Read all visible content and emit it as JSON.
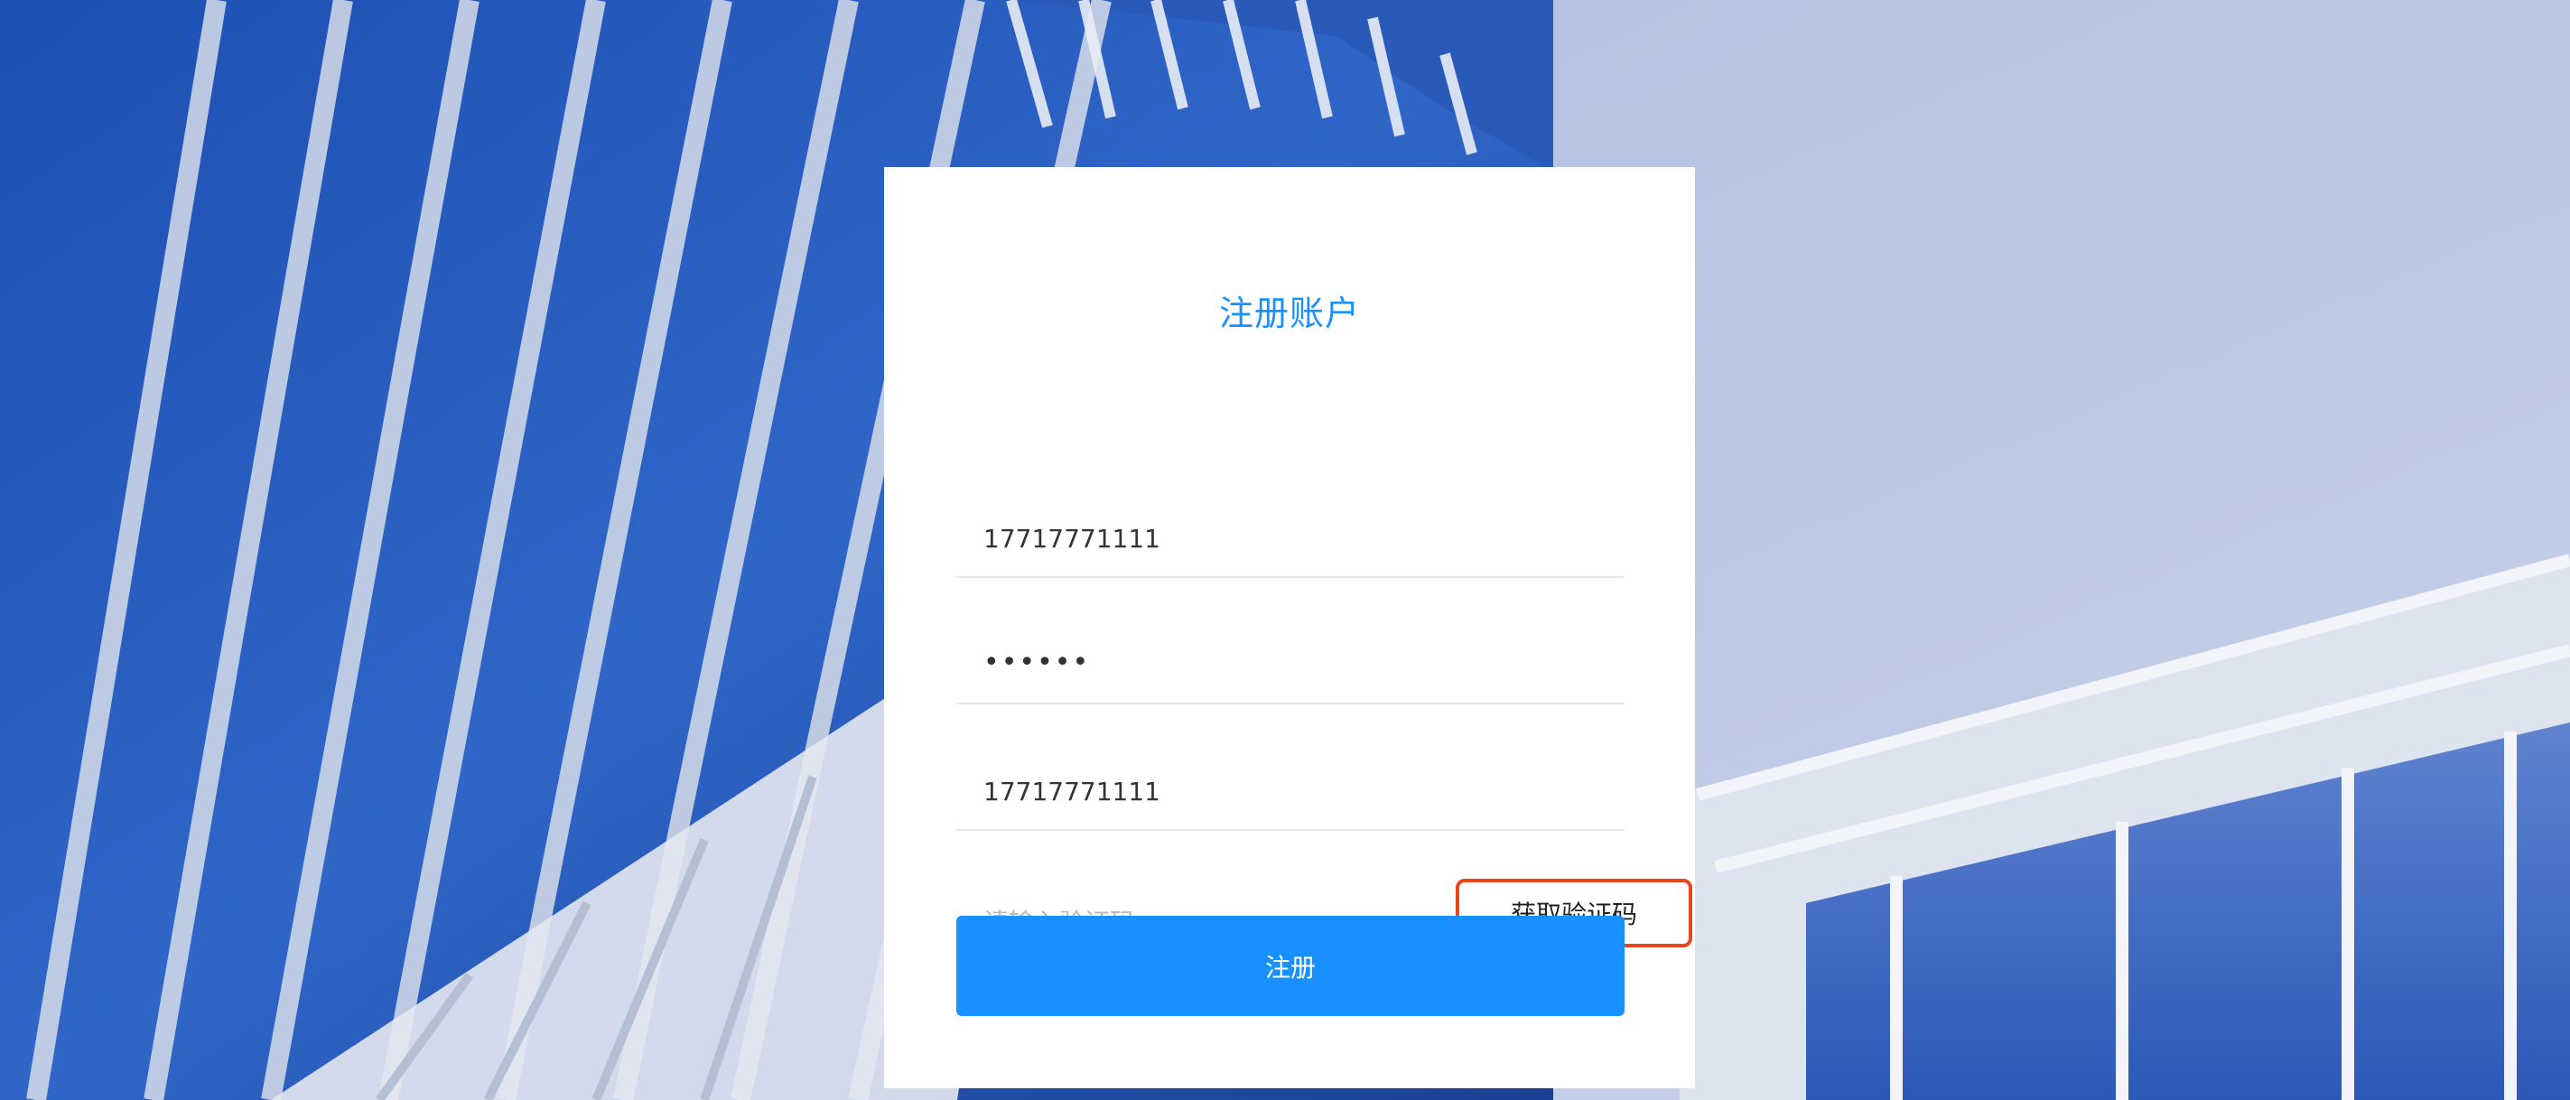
{
  "form": {
    "title": "注册账户",
    "phone_value": "17717771111",
    "password_value": "••••••",
    "phone2_value": "17717771111",
    "code_placeholder": "请输入验证码",
    "get_code_label": "获取验证码",
    "submit_label": "注册"
  },
  "colors": {
    "accent": "#1890ff",
    "highlight_border": "#e8471c",
    "card_bg": "#ffffff"
  },
  "icons": {
    "background": "building-photo"
  }
}
